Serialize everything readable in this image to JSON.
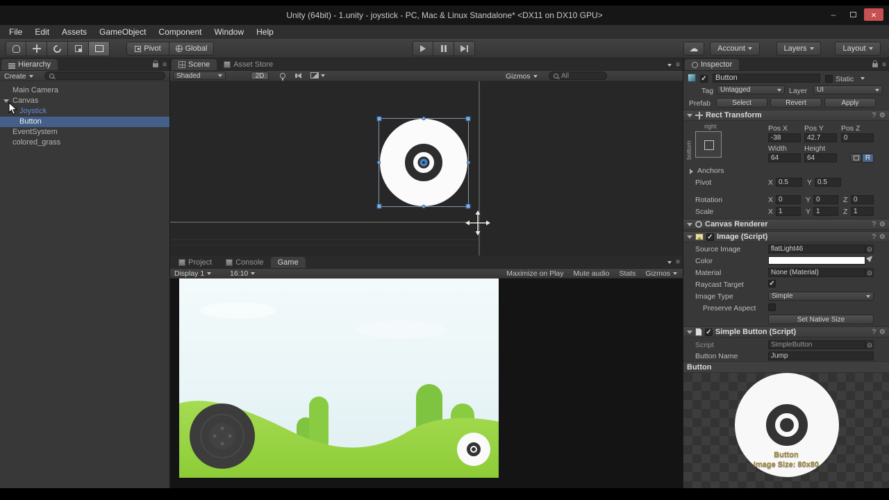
{
  "icons": {
    "check": "✓",
    "menu": "≡",
    "cloud": "☁",
    "gear": "⚙",
    "help": "?",
    "picker": "⊙",
    "close": "×",
    "minimize": "–"
  },
  "title_bar": {
    "title": "Unity (64bit) - 1.unity - joystick - PC, Mac & Linux Standalone* <DX11 on DX10 GPU>"
  },
  "menu": {
    "items": [
      "File",
      "Edit",
      "Assets",
      "GameObject",
      "Component",
      "Window",
      "Help"
    ]
  },
  "toolbar": {
    "pivot": "Pivot",
    "global": "Global",
    "account": "Account",
    "layers": "Layers",
    "layout": "Layout"
  },
  "hierarchy": {
    "tab": "Hierarchy",
    "create": "Create",
    "items": [
      {
        "label": "Main Camera"
      },
      {
        "label": "Canvas"
      },
      {
        "label": "Joystick"
      },
      {
        "label": "Button"
      },
      {
        "label": "EventSystem"
      },
      {
        "label": "colored_grass"
      }
    ]
  },
  "scene": {
    "tab_scene": "Scene",
    "tab_asset_store": "Asset Store",
    "shaded": "Shaded",
    "mode_2d": "2D",
    "gizmos": "Gizmos",
    "search_all": "All"
  },
  "bottom_panel": {
    "tab_project": "Project",
    "tab_console": "Console",
    "tab_game": "Game",
    "display": "Display 1",
    "aspect": "16:10",
    "maximize_on_play": "Maximize on Play",
    "mute_audio": "Mute audio",
    "stats": "Stats",
    "gizmos": "Gizmos"
  },
  "inspector": {
    "tab": "Inspector",
    "name": "Button",
    "static": "Static",
    "tag_label": "Tag",
    "tag_value": "Untagged",
    "layer_label": "Layer",
    "layer_value": "UI",
    "prefab_label": "Prefab",
    "prefab_select": "Select",
    "prefab_revert": "Revert",
    "prefab_apply": "Apply",
    "rect_transform": {
      "title": "Rect Transform",
      "anchor_right": "right",
      "anchor_bottom": "bottom",
      "pos_x_label": "Pos X",
      "pos_y_label": "Pos Y",
      "pos_z_label": "Pos Z",
      "pos_x": "-38",
      "pos_y": "42.7",
      "pos_z": "0",
      "width_label": "Width",
      "height_label": "Height",
      "width": "64",
      "height": "64",
      "anchors": "Anchors",
      "pivot": "Pivot",
      "rotation": "Rotation",
      "scale": "Scale",
      "x": "X",
      "y": "Y",
      "z": "Z",
      "pivot_x": "0.5",
      "pivot_y": "0.5",
      "rot_x": "0",
      "rot_y": "0",
      "rot_z": "0",
      "scale_x": "1",
      "scale_y": "1",
      "scale_z": "1",
      "raw_edit": "R"
    },
    "canvas_renderer": {
      "title": "Canvas Renderer"
    },
    "image": {
      "title": "Image (Script)",
      "source_image_label": "Source Image",
      "source_image_value": "flatLight46",
      "color_label": "Color",
      "material_label": "Material",
      "material_value": "None (Material)",
      "raycast_label": "Raycast Target",
      "image_type_label": "Image Type",
      "image_type_value": "Simple",
      "preserve_label": "Preserve Aspect",
      "set_native_size": "Set Native Size"
    },
    "simple_button": {
      "title": "Simple Button (Script)",
      "script_label": "Script",
      "script_value": "SimpleButton",
      "button_name_label": "Button Name",
      "button_name_value": "Jump"
    },
    "preview": {
      "header": "Button",
      "caption_name": "Button",
      "caption_size": "Image Size: 80x80"
    }
  }
}
